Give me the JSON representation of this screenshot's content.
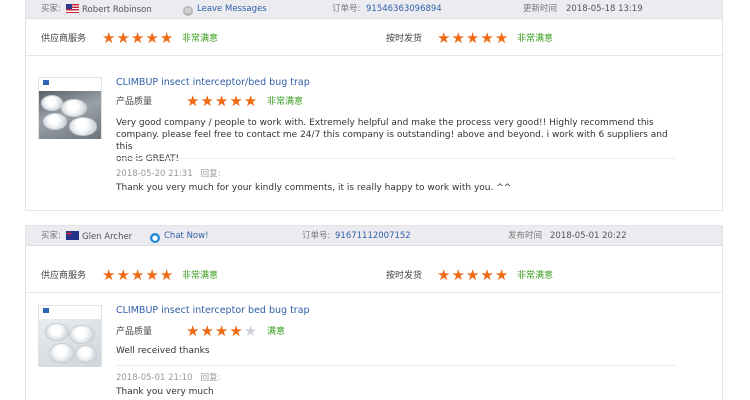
{
  "reviews": [
    {
      "buyer_label": "买家:",
      "buyer_flag": "US",
      "buyer_name": "Robert Robinson",
      "contact_icon": "message-icon",
      "contact_label": "Leave Messages",
      "order_label": "订单号:",
      "order_no": "91546363096894",
      "date_label": "更新时间",
      "date": "2018-05-18 13:19",
      "supplier_service_label": "供应商服务",
      "supplier_service_stars": 5,
      "supplier_service_text": "非常满意",
      "ontime_label": "按时发货",
      "ontime_stars": 5,
      "ontime_text": "非常满意",
      "product_title": "CLIMBUP insect interceptor/bed bug trap",
      "quality_label": "产品质量",
      "quality_stars": 5,
      "quality_text": "非常满意",
      "comment_lines": [
        "Very good company / people to work with. Extremely helpful and make the process very good!! Highly recommend this",
        "company. please feel free to contact me 24/7 this company is outstanding! above and beyond. i work with 6 suppliers and this",
        "one is GREAT!"
      ],
      "comment_date": "2018-05-20 21:31",
      "reply_label": "回复:",
      "reply_text": "Thank you very much for your kindly comments, it is really happy to work with you. ^^"
    },
    {
      "buyer_label": "买家:",
      "buyer_flag": "AU",
      "buyer_name": "Glen Archer",
      "contact_icon": "chat-icon",
      "contact_label": "Chat Now!",
      "order_label": "订单号:",
      "order_no": "91671112007152",
      "date_label": "发布时间",
      "date": "2018-05-01 20:22",
      "supplier_service_label": "供应商服务",
      "supplier_service_stars": 5,
      "supplier_service_text": "非常满意",
      "ontime_label": "按时发货",
      "ontime_stars": 5,
      "ontime_text": "非常满意",
      "product_title": "CLIMBUP insect interceptor bed bug trap",
      "quality_label": "产品质量",
      "quality_stars": 4,
      "quality_text": "满意",
      "comment_lines": [
        "Well received thanks"
      ],
      "comment_date": "2018-05-01 21:10",
      "reply_label": "回复:",
      "reply_text": "Thank you very much"
    }
  ],
  "colors": {
    "star_on": "#ee6a15",
    "star_off": "#cfd3d9",
    "satisfied": "#3a9c1f",
    "link": "#2f5fa8"
  }
}
